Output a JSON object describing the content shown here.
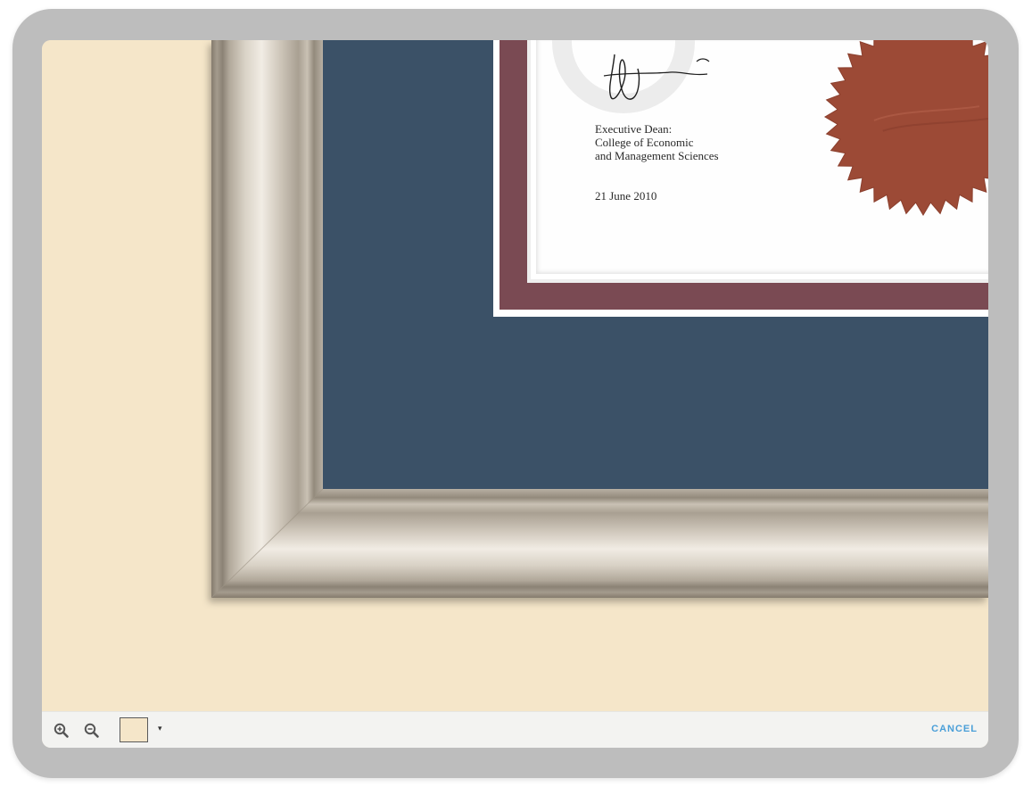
{
  "viewer": {
    "background_color": "#f5e6c9",
    "mat_color": "#3b5167",
    "inner_mat_color": "#7a4a53",
    "seal_color": "#9c4a36"
  },
  "certificate": {
    "signatory_line1": "Executive Dean:",
    "signatory_line2": "College of Economic",
    "signatory_line3": "and Management Sciences",
    "date": "21 June 2010"
  },
  "toolbar": {
    "zoom_in_icon": "zoom-in-icon",
    "zoom_out_icon": "zoom-out-icon",
    "swatch_color": "#f5e6c9",
    "swatch_caret": "▾",
    "cancel_label": "CANCEL"
  }
}
